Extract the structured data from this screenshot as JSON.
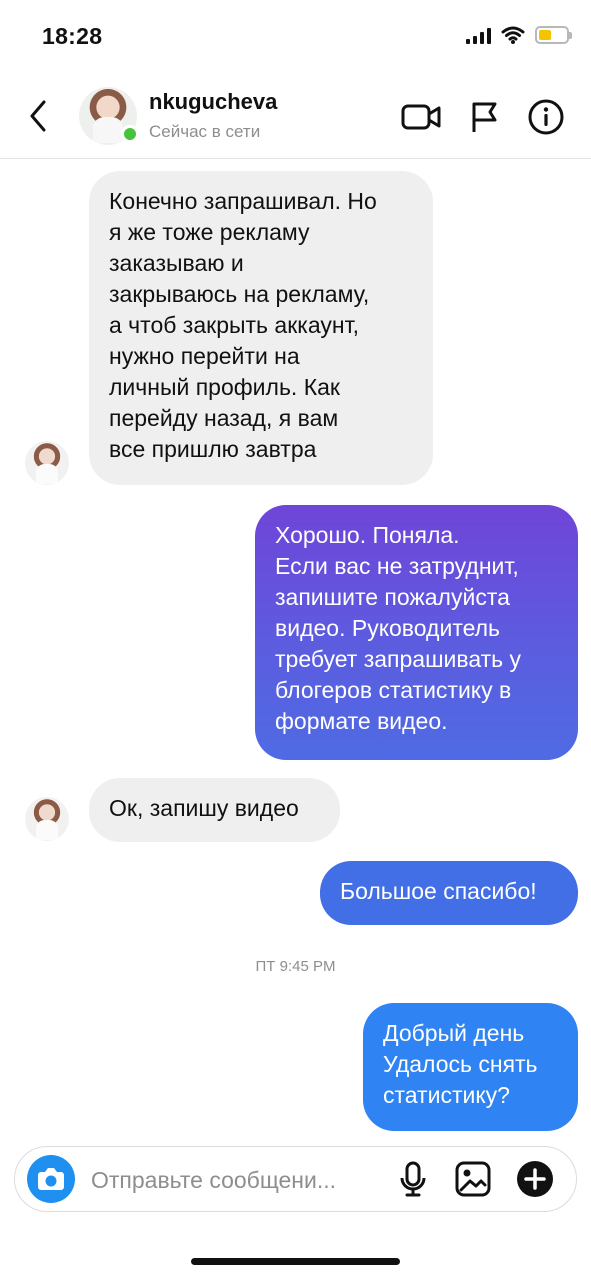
{
  "status_bar": {
    "time": "18:28"
  },
  "header": {
    "username": "nkugucheva",
    "presence": "Сейчас в сети",
    "icons": {
      "back": "chevron-left-icon",
      "video": "video-camera-icon",
      "flag": "flag-icon",
      "info": "info-icon"
    }
  },
  "messages": {
    "m1": {
      "text": "Конечно запрашивал. Но\nя же тоже рекламу\nзаказываю и\nзакрываюсь на рекламу,\nа чтоб закрыть аккаунт,\nнужно перейти на\nличный профиль. Как\nперейду назад, я вам\nвсе пришлю завтра"
    },
    "m2": {
      "text": "Хорошо. Поняла.\nЕсли вас не затруднит,\nзапишите пожалуйста\nвидео. Руководитель\nтребует запрашивать у\nблогеров статистику в\nформате видео."
    },
    "m3": {
      "text": "Ок, запишу видео"
    },
    "m4": {
      "text": "Большое спасибо!"
    },
    "timestamp": "ПТ 9:45 PM",
    "m5": {
      "text": "Добрый день\nУдалось снять\nстатистику?"
    }
  },
  "composer": {
    "placeholder": "Отправьте сообщени...",
    "icons": {
      "camera": "camera-icon",
      "mic": "microphone-icon",
      "gallery": "image-icon",
      "add": "plus-circle-icon"
    }
  },
  "colors": {
    "incoming_bubble": "#efefef",
    "purple": "#6e4ad9",
    "blue": "#2f83f2",
    "online": "#45c33a",
    "battery": "#f5c400"
  }
}
